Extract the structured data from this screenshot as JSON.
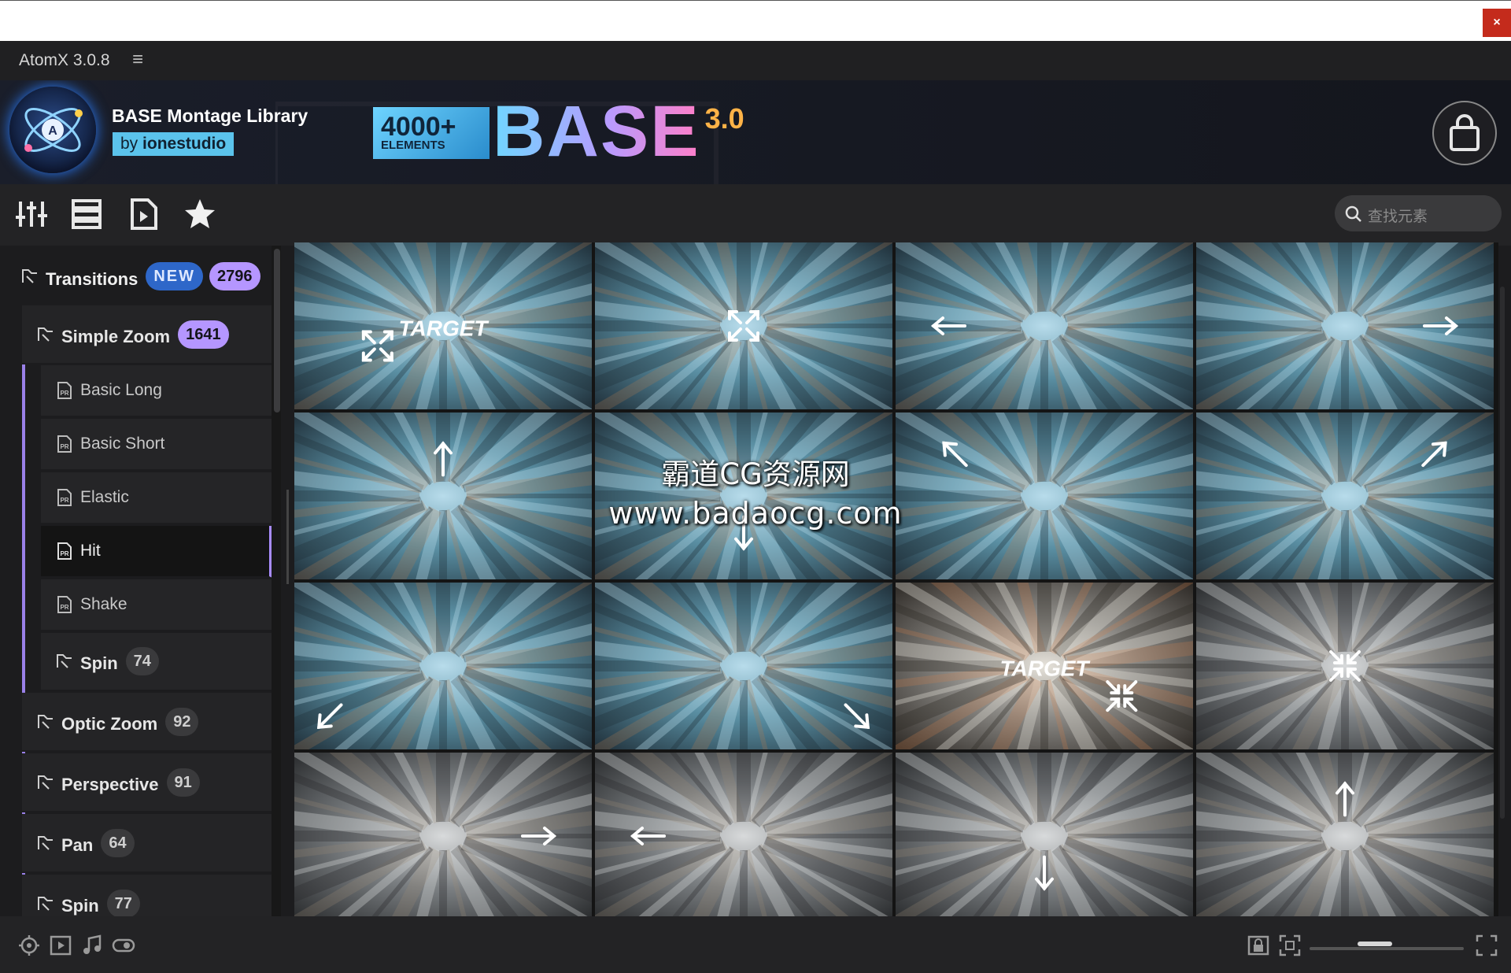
{
  "window": {
    "close_glyph": "×"
  },
  "app": {
    "title": "AtomX 3.0.8",
    "menu_glyph": "≡"
  },
  "banner": {
    "library_title": "BASE Montage Library",
    "by_prefix": "by",
    "author": "ionestudio",
    "promo_count": "4000+",
    "promo_elements": "ELEMENTS",
    "promo_word": "BASE",
    "promo_version": "3.0",
    "accent_color": "#5bc3ec"
  },
  "toolbar": {
    "icons": [
      "sliders-icon",
      "list-view-icon",
      "video-file-icon",
      "favorites-star-icon"
    ],
    "search_placeholder": "查找元素"
  },
  "sidebar": {
    "category": {
      "label": "Transitions",
      "badge_new": "NEW",
      "count": "2796"
    },
    "sub_category": {
      "label": "Simple Zoom",
      "count": "1641"
    },
    "leaves": [
      {
        "label": "Basic Long"
      },
      {
        "label": "Basic Short"
      },
      {
        "label": "Elastic"
      },
      {
        "label": "Hit",
        "selected": true
      },
      {
        "label": "Shake"
      }
    ],
    "spin_nested": {
      "label": "Spin",
      "count": "74"
    },
    "siblings": [
      {
        "label": "Optic Zoom",
        "count": "92"
      },
      {
        "label": "Perspective",
        "count": "91"
      },
      {
        "label": "Pan",
        "count": "64"
      },
      {
        "label": "Spin",
        "count": "77"
      }
    ]
  },
  "grid": {
    "thumbnails": [
      {
        "label": "TARGET",
        "icon": "expand-icon",
        "tone": "blue"
      },
      {
        "label": "",
        "icon": "expand-icon",
        "tone": "blue"
      },
      {
        "label": "",
        "icon": "arrow-left-icon",
        "tone": "blue"
      },
      {
        "label": "",
        "icon": "arrow-right-icon",
        "tone": "blue"
      },
      {
        "label": "",
        "icon": "arrow-up-icon",
        "tone": "blue"
      },
      {
        "label": "",
        "icon": "arrow-down-icon",
        "tone": "blue"
      },
      {
        "label": "",
        "icon": "arrow-up-left-icon",
        "tone": "blue"
      },
      {
        "label": "",
        "icon": "arrow-up-right-icon",
        "tone": "blue"
      },
      {
        "label": "",
        "icon": "arrow-down-left-icon",
        "tone": "blue"
      },
      {
        "label": "",
        "icon": "arrow-down-right-icon",
        "tone": "blue"
      },
      {
        "label": "TARGET",
        "icon": "collapse-icon",
        "tone": "warm"
      },
      {
        "label": "",
        "icon": "collapse-icon",
        "tone": "gray"
      },
      {
        "label": "",
        "icon": "arrow-right-icon",
        "tone": "gray"
      },
      {
        "label": "",
        "icon": "arrow-left-icon",
        "tone": "gray"
      },
      {
        "label": "",
        "icon": "arrow-down-icon",
        "tone": "gray"
      },
      {
        "label": "",
        "icon": "arrow-up-icon",
        "tone": "gray"
      }
    ]
  },
  "watermark": {
    "line1": "霸道CG资源网",
    "line2": "www.badaocg.com"
  },
  "statusbar": {
    "left_icons": [
      "compass-icon",
      "video-icon",
      "music-icon",
      "toggle-icon"
    ],
    "right_icons": [
      "lock-icon",
      "fit-screen-icon",
      "fullscreen-icon"
    ],
    "zoom_level": 0.4
  }
}
